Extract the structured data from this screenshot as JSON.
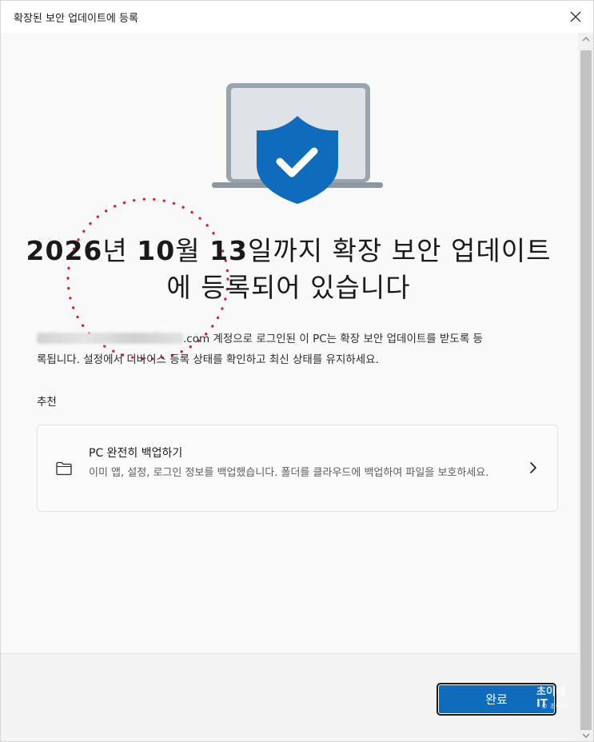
{
  "window": {
    "title": "확장된 보안 업데이트에 등록"
  },
  "headline": {
    "year": "2026",
    "year_suffix": "년 ",
    "month": "10",
    "month_suffix": "월 ",
    "day": "13",
    "day_suffix": "일까지 확장 보안 업데이트",
    "line2": "에 등록되어 있습니다"
  },
  "description": {
    "email_suffix": ".com 계정으로 로그인된 이 PC는 확장 보안 업데이트를 받도록 등",
    "line2": "록됩니다. 설정에서 디바이스 등록 상태를 확인하고 최신 상태를 유지하세요."
  },
  "recommendation": {
    "label": "추천",
    "card": {
      "title": "PC 완전히 백업하기",
      "desc": "이미 앱, 설정, 로그인 정보를 백업했습니다. 폴더를 클라우드에 백업하여 파일을 보호하세요.",
      "icon": "folder-icon"
    }
  },
  "footer": {
    "done_label": "완료",
    "watermark": "초이네 IT",
    "watermark_sub": "© 초이네"
  },
  "colors": {
    "accent": "#0f6cbd",
    "shield": "#0f6cbd",
    "stamp": "#e8112d"
  }
}
